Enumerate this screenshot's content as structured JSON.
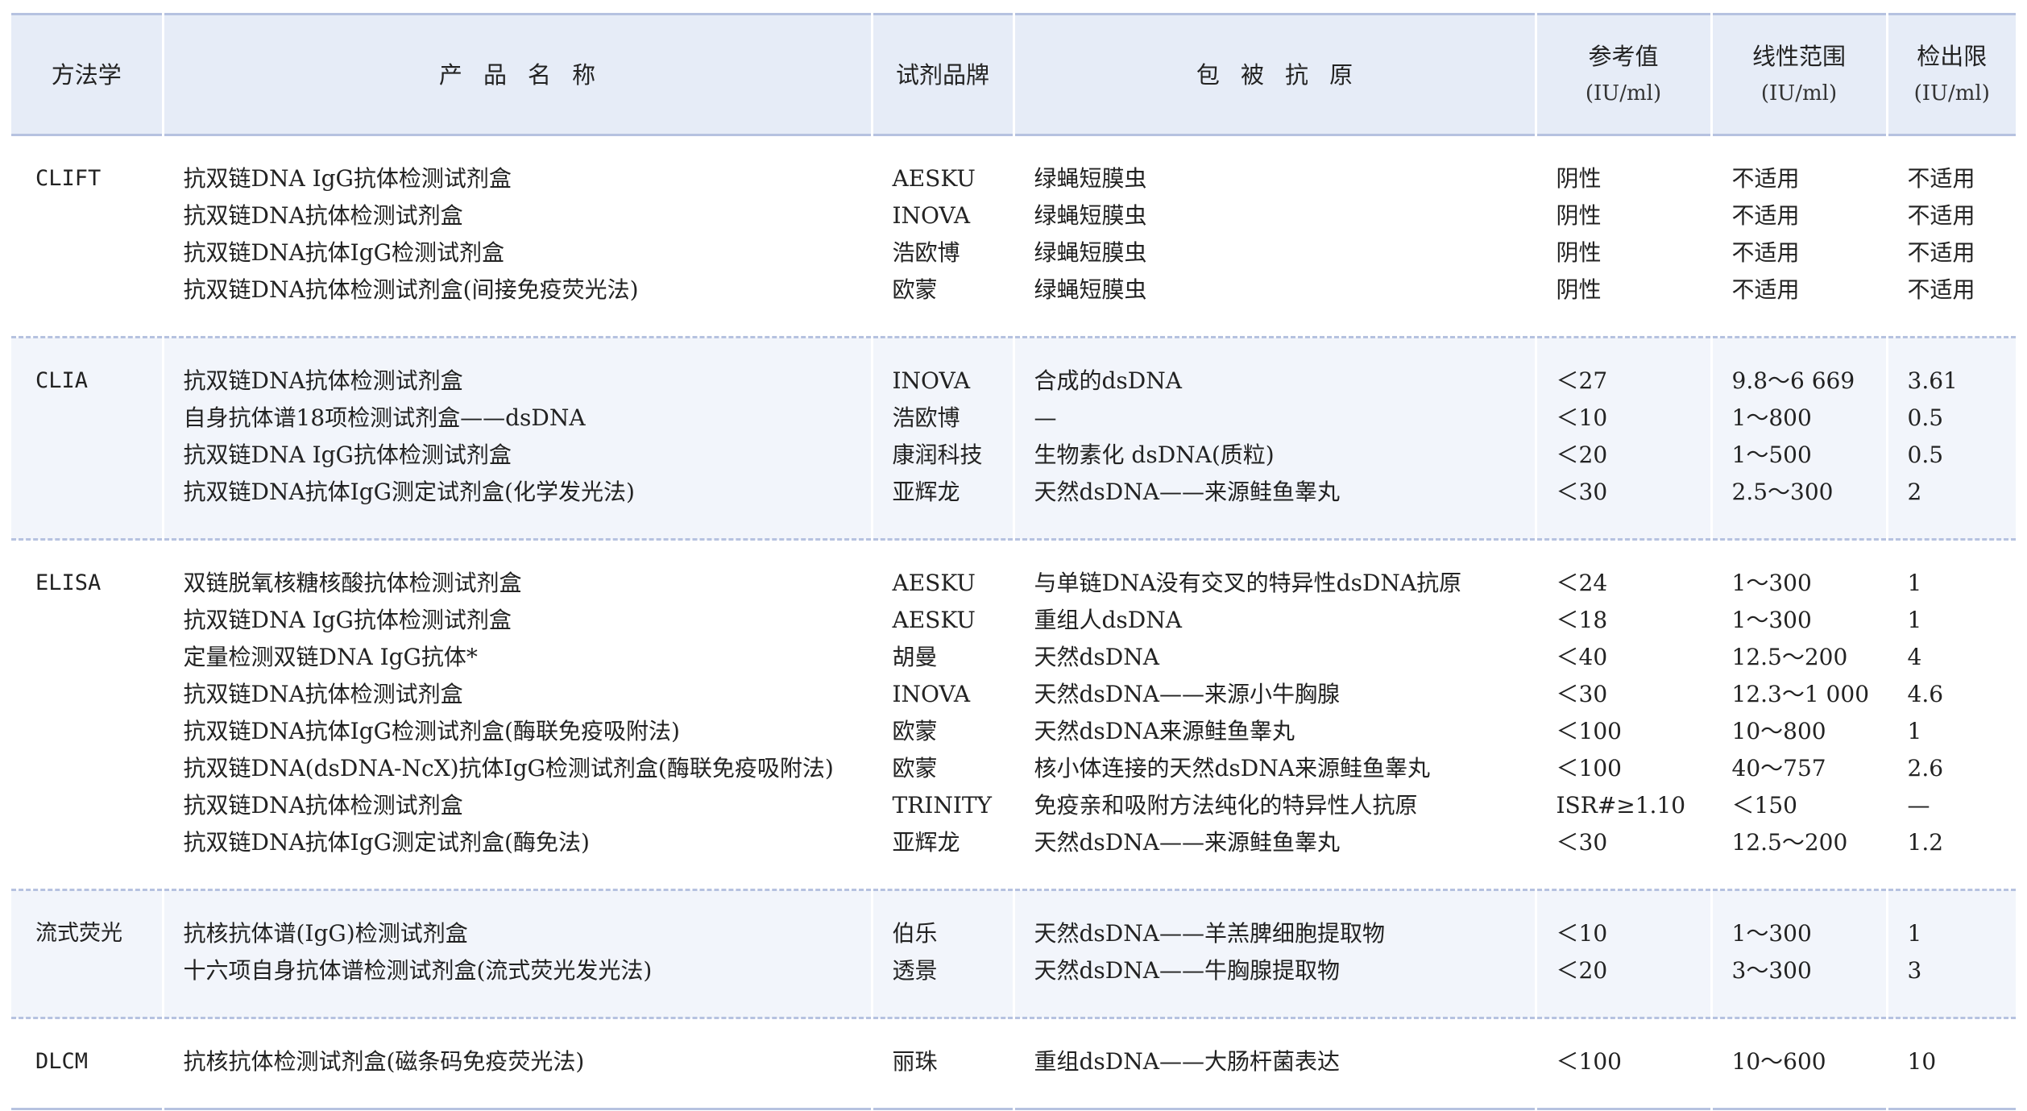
{
  "header": {
    "method": "方法学",
    "product": "产品名称",
    "brand": "试剂品牌",
    "antigen": "包被抗原",
    "ref_value": "参考值",
    "ref_unit": "(IU/ml)",
    "linear_range": "线性范围",
    "linear_unit": "(IU/ml)",
    "lod": "检出限",
    "lod_unit": "(IU/ml)"
  },
  "groups": [
    {
      "method": "CLIFT",
      "rows": [
        {
          "product": "抗双链DNA IgG抗体检测试剂盒",
          "brand": "AESKU",
          "antigen": "绿蝇短膜虫",
          "ref": "阴性",
          "linear": "不适用",
          "lod": "不适用"
        },
        {
          "product": "抗双链DNA抗体检测试剂盒",
          "brand": "INOVA",
          "antigen": "绿蝇短膜虫",
          "ref": "阴性",
          "linear": "不适用",
          "lod": "不适用"
        },
        {
          "product": "抗双链DNA抗体IgG检测试剂盒",
          "brand": "浩欧博",
          "antigen": "绿蝇短膜虫",
          "ref": "阴性",
          "linear": "不适用",
          "lod": "不适用"
        },
        {
          "product": "抗双链DNA抗体检测试剂盒(间接免疫荧光法)",
          "brand": "欧蒙",
          "antigen": "绿蝇短膜虫",
          "ref": "阴性",
          "linear": "不适用",
          "lod": "不适用"
        }
      ]
    },
    {
      "method": "CLIA",
      "rows": [
        {
          "product": "抗双链DNA抗体检测试剂盒",
          "brand": "INOVA",
          "antigen": "合成的dsDNA",
          "ref": "＜27",
          "linear": "9.8～6 669",
          "lod": "3.61"
        },
        {
          "product": "自身抗体谱18项检测试剂盒——dsDNA",
          "brand": "浩欧博",
          "antigen": "—",
          "ref": "＜10",
          "linear": "1～800",
          "lod": "0.5"
        },
        {
          "product": "抗双链DNA IgG抗体检测试剂盒",
          "brand": "康润科技",
          "antigen": "生物素化 dsDNA(质粒)",
          "ref": "＜20",
          "linear": "1～500",
          "lod": "0.5"
        },
        {
          "product": "抗双链DNA抗体IgG测定试剂盒(化学发光法)",
          "brand": "亚辉龙",
          "antigen": "天然dsDNA——来源鲑鱼睾丸",
          "ref": "＜30",
          "linear": "2.5～300",
          "lod": "2"
        }
      ]
    },
    {
      "method": "ELISA",
      "rows": [
        {
          "product": "双链脱氧核糖核酸抗体检测试剂盒",
          "brand": "AESKU",
          "antigen": "与单链DNA没有交叉的特异性dsDNA抗原",
          "ref": "＜24",
          "linear": "1～300",
          "lod": "1"
        },
        {
          "product": "抗双链DNA IgG抗体检测试剂盒",
          "brand": "AESKU",
          "antigen": "重组人dsDNA",
          "ref": "＜18",
          "linear": "1～300",
          "lod": "1"
        },
        {
          "product": "定量检测双链DNA IgG抗体*",
          "brand": "胡曼",
          "antigen": "天然dsDNA",
          "ref": "＜40",
          "linear": "12.5～200",
          "lod": "4"
        },
        {
          "product": "抗双链DNA抗体检测试剂盒",
          "brand": "INOVA",
          "antigen": "天然dsDNA——来源小牛胸腺",
          "ref": "＜30",
          "linear": "12.3～1 000",
          "lod": "4.6"
        },
        {
          "product": "抗双链DNA抗体IgG检测试剂盒(酶联免疫吸附法)",
          "brand": "欧蒙",
          "antigen": "天然dsDNA来源鲑鱼睾丸",
          "ref": "＜100",
          "linear": "10～800",
          "lod": "1"
        },
        {
          "product": "抗双链DNA(dsDNA-NcX)抗体IgG检测试剂盒(酶联免疫吸附法)",
          "brand": "欧蒙",
          "antigen": "核小体连接的天然dsDNA来源鲑鱼睾丸",
          "ref": "＜100",
          "linear": "40～757",
          "lod": "2.6"
        },
        {
          "product": "抗双链DNA抗体检测试剂盒",
          "brand": "TRINITY",
          "antigen": "免疫亲和吸附方法纯化的特异性人抗原",
          "ref": "ISR#≥1.10",
          "linear": "＜150",
          "lod": "—"
        },
        {
          "product": "抗双链DNA抗体IgG测定试剂盒(酶免法)",
          "brand": "亚辉龙",
          "antigen": "天然dsDNA——来源鲑鱼睾丸",
          "ref": "＜30",
          "linear": "12.5～200",
          "lod": "1.2"
        }
      ]
    },
    {
      "method": "流式荧光",
      "rows": [
        {
          "product": "抗核抗体谱(IgG)检测试剂盒",
          "brand": "伯乐",
          "antigen": "天然dsDNA——羊羔脾细胞提取物",
          "ref": "＜10",
          "linear": "1～300",
          "lod": "1"
        },
        {
          "product": "十六项自身抗体谱检测试剂盒(流式荧光发光法)",
          "brand": "透景",
          "antigen": "天然dsDNA——牛胸腺提取物",
          "ref": "＜20",
          "linear": "3～300",
          "lod": "3"
        }
      ]
    },
    {
      "method": "DLCM",
      "rows": [
        {
          "product": "抗核抗体检测试剂盒(磁条码免疫荧光法)",
          "brand": "丽珠",
          "antigen": "重组dsDNA——大肠杆菌表达",
          "ref": "＜100",
          "linear": "10～600",
          "lod": "10"
        }
      ]
    }
  ]
}
